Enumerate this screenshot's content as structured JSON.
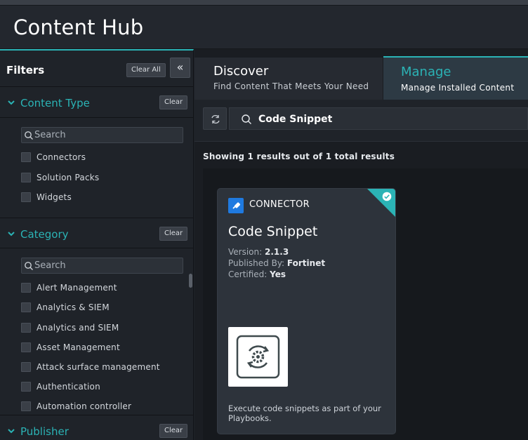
{
  "header": {
    "title": "Content Hub"
  },
  "sidebar": {
    "title": "Filters",
    "clear_all": "Clear All",
    "collapse_glyph": "«",
    "sections": [
      {
        "title": "Content Type",
        "clear": "Clear",
        "search_placeholder": "Search",
        "items": [
          "Connectors",
          "Solution Packs",
          "Widgets"
        ]
      },
      {
        "title": "Category",
        "clear": "Clear",
        "search_placeholder": "Search",
        "items": [
          "Alert Management",
          "Analytics & SIEM",
          "Analytics and SIEM",
          "Asset Management",
          "Attack surface management",
          "Authentication",
          "Automation controller"
        ]
      },
      {
        "title": "Publisher",
        "clear": "Clear"
      }
    ]
  },
  "tabs": [
    {
      "title": "Discover",
      "subtitle": "Find Content That Meets Your Need",
      "active": false
    },
    {
      "title": "Manage",
      "subtitle": "Manage Installed Content",
      "active": true
    }
  ],
  "search": {
    "value": "Code Snippet"
  },
  "results": {
    "text": "Showing 1 results out of 1 total results"
  },
  "card": {
    "type": "CONNECTOR",
    "name": "Code Snippet",
    "version_label": "Version:",
    "version": "2.1.3",
    "published_label": "Published By:",
    "published": "Fortinet",
    "certified_label": "Certified:",
    "certified": "Yes",
    "description": "Execute code snippets as part of your Playbooks.",
    "installed": true
  },
  "colors": {
    "accent": "#2bb3b5",
    "background": "#1e2228",
    "card": "#2d333b"
  }
}
